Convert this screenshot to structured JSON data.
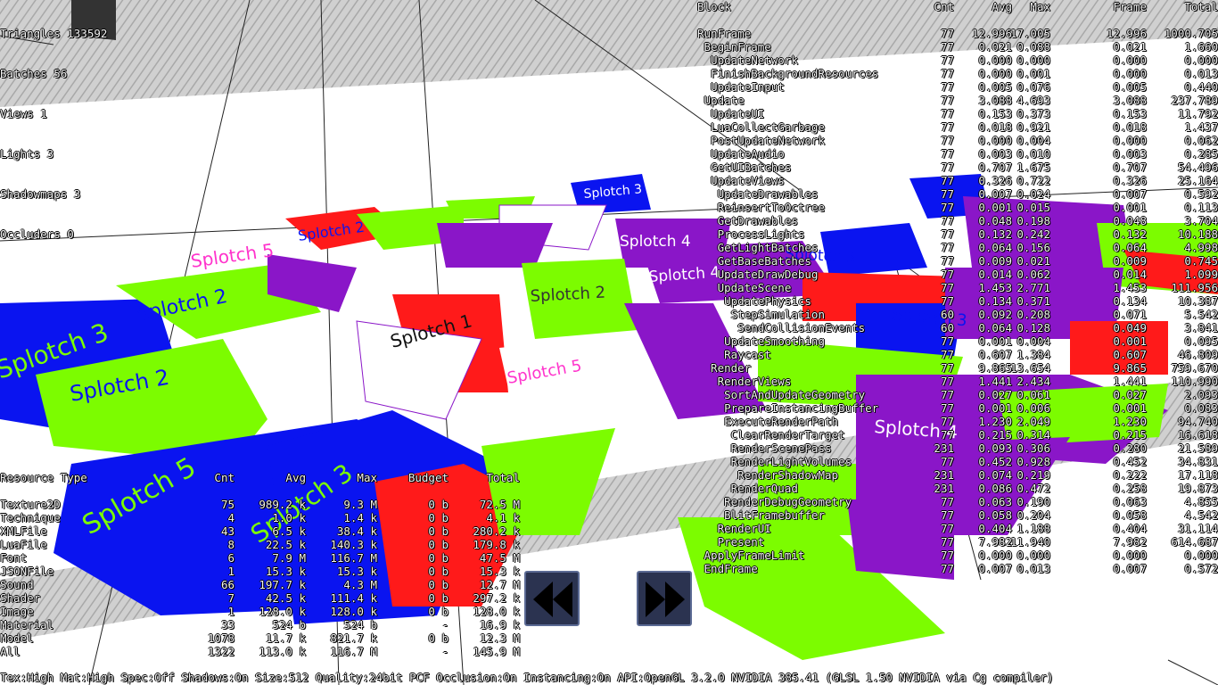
{
  "scene": {
    "splotch_labels": [
      "Splotch 1",
      "Splotch 2",
      "Splotch 3",
      "Splotch 4",
      "Splotch 5"
    ],
    "colors": {
      "green": "#7cfc00",
      "blue": "#0a14f0",
      "purple": "#8a16c8",
      "red": "#ff1a1a",
      "magenta": "#ff33cc",
      "white": "#ffffff",
      "slab": "#c8c8c8"
    }
  },
  "stats": [
    "Triangles 133592",
    "Batches 56",
    "Views 1",
    "Lights 3",
    "Shadowmaps 3",
    "Occluders 0"
  ],
  "profiler": {
    "headers": {
      "block": "Block",
      "cnt": "Cnt",
      "avg": "Avg",
      "max": "Max",
      "frame": "Frame",
      "total": "Total"
    },
    "rows": [
      {
        "name": "RunFrame",
        "cnt": "77",
        "avg": "12.996",
        "max": "17.005",
        "frame": "12.996",
        "total": "1000.705"
      },
      {
        "name": " BeginFrame",
        "cnt": "77",
        "avg": "0.021",
        "max": "0.088",
        "frame": "0.021",
        "total": "1.660"
      },
      {
        "name": "  UpdateNetwork",
        "cnt": "77",
        "avg": "0.000",
        "max": "0.000",
        "frame": "0.000",
        "total": "0.000"
      },
      {
        "name": "  FinishBackgroundResources",
        "cnt": "77",
        "avg": "0.000",
        "max": "0.001",
        "frame": "0.000",
        "total": "0.013"
      },
      {
        "name": "  UpdateInput",
        "cnt": "77",
        "avg": "0.005",
        "max": "0.076",
        "frame": "0.005",
        "total": "0.440"
      },
      {
        "name": " Update",
        "cnt": "77",
        "avg": "3.088",
        "max": "4.693",
        "frame": "3.088",
        "total": "237.789"
      },
      {
        "name": "  UpdateUI",
        "cnt": "77",
        "avg": "0.153",
        "max": "0.373",
        "frame": "0.153",
        "total": "11.792"
      },
      {
        "name": "  LuaCollectGarbage",
        "cnt": "77",
        "avg": "0.018",
        "max": "0.921",
        "frame": "0.018",
        "total": "1.437"
      },
      {
        "name": "  PostUpdateNetwork",
        "cnt": "77",
        "avg": "0.000",
        "max": "0.004",
        "frame": "0.000",
        "total": "0.062"
      },
      {
        "name": "  UpdateAudio",
        "cnt": "77",
        "avg": "0.003",
        "max": "0.010",
        "frame": "0.003",
        "total": "0.285"
      },
      {
        "name": "  GetUIBatches",
        "cnt": "77",
        "avg": "0.707",
        "max": "1.675",
        "frame": "0.707",
        "total": "54.496"
      },
      {
        "name": "  UpdateViews",
        "cnt": "77",
        "avg": "0.326",
        "max": "0.722",
        "frame": "0.326",
        "total": "25.164"
      },
      {
        "name": "   UpdateDrawables",
        "cnt": "77",
        "avg": "0.007",
        "max": "0.024",
        "frame": "0.007",
        "total": "0.592"
      },
      {
        "name": "   ReinsertToOctree",
        "cnt": "77",
        "avg": "0.001",
        "max": "0.015",
        "frame": "0.001",
        "total": "0.113"
      },
      {
        "name": "   GetDrawables",
        "cnt": "77",
        "avg": "0.048",
        "max": "0.198",
        "frame": "0.048",
        "total": "3.704"
      },
      {
        "name": "   ProcessLights",
        "cnt": "77",
        "avg": "0.132",
        "max": "0.242",
        "frame": "0.132",
        "total": "10.188"
      },
      {
        "name": "   GetLightBatches",
        "cnt": "77",
        "avg": "0.064",
        "max": "0.156",
        "frame": "0.064",
        "total": "4.998"
      },
      {
        "name": "   GetBaseBatches",
        "cnt": "77",
        "avg": "0.009",
        "max": "0.021",
        "frame": "0.009",
        "total": "0.745"
      },
      {
        "name": "   UpdateDrawDebug",
        "cnt": "77",
        "avg": "0.014",
        "max": "0.062",
        "frame": "0.014",
        "total": "1.099"
      },
      {
        "name": "   UpdateScene",
        "cnt": "77",
        "avg": "1.453",
        "max": "2.771",
        "frame": "1.453",
        "total": "111.956"
      },
      {
        "name": "    UpdatePhysics",
        "cnt": "77",
        "avg": "0.134",
        "max": "0.371",
        "frame": "0.134",
        "total": "10.387"
      },
      {
        "name": "     StepSimulation",
        "cnt": "60",
        "avg": "0.092",
        "max": "0.208",
        "frame": "0.071",
        "total": "5.542"
      },
      {
        "name": "      SendCollisionEvents",
        "cnt": "60",
        "avg": "0.064",
        "max": "0.128",
        "frame": "0.049",
        "total": "3.841"
      },
      {
        "name": "    UpdateSmoothing",
        "cnt": "77",
        "avg": "0.001",
        "max": "0.004",
        "frame": "0.001",
        "total": "0.095"
      },
      {
        "name": "    Raycast",
        "cnt": "77",
        "avg": "0.607",
        "max": "1.384",
        "frame": "0.607",
        "total": "46.809"
      },
      {
        "name": "  Render",
        "cnt": "77",
        "avg": "9.865",
        "max": "13.654",
        "frame": "9.865",
        "total": "759.670"
      },
      {
        "name": "   RenderViews",
        "cnt": "77",
        "avg": "1.441",
        "max": "2.434",
        "frame": "1.441",
        "total": "110.990"
      },
      {
        "name": "    SortAndUpdateGeometry",
        "cnt": "77",
        "avg": "0.027",
        "max": "0.061",
        "frame": "0.027",
        "total": "2.093"
      },
      {
        "name": "    PrepareInstancingBuffer",
        "cnt": "77",
        "avg": "0.001",
        "max": "0.006",
        "frame": "0.001",
        "total": "0.083"
      },
      {
        "name": "    ExecuteRenderPath",
        "cnt": "77",
        "avg": "1.230",
        "max": "2.049",
        "frame": "1.230",
        "total": "94.740"
      },
      {
        "name": "     ClearRenderTarget",
        "cnt": "77",
        "avg": "0.215",
        "max": "0.314",
        "frame": "0.215",
        "total": "16.618"
      },
      {
        "name": "     RenderScenePass",
        "cnt": "231",
        "avg": "0.093",
        "max": "0.306",
        "frame": "0.280",
        "total": "21.589"
      },
      {
        "name": "     RenderLightVolumes",
        "cnt": "77",
        "avg": "0.452",
        "max": "0.928",
        "frame": "0.452",
        "total": "34.831"
      },
      {
        "name": "      RenderShadowMap",
        "cnt": "231",
        "avg": "0.074",
        "max": "0.219",
        "frame": "0.222",
        "total": "17.118"
      },
      {
        "name": "     RenderQuad",
        "cnt": "231",
        "avg": "0.086",
        "max": "0.472",
        "frame": "0.258",
        "total": "19.873"
      },
      {
        "name": "    RenderDebugGeometry",
        "cnt": "77",
        "avg": "0.063",
        "max": "0.190",
        "frame": "0.063",
        "total": "4.855"
      },
      {
        "name": "    BlitFramebuffer",
        "cnt": "77",
        "avg": "0.058",
        "max": "0.204",
        "frame": "0.058",
        "total": "4.542"
      },
      {
        "name": "   RenderUI",
        "cnt": "77",
        "avg": "0.404",
        "max": "1.188",
        "frame": "0.404",
        "total": "31.114"
      },
      {
        "name": "   Present",
        "cnt": "77",
        "avg": "7.982",
        "max": "11.940",
        "frame": "7.982",
        "total": "614.687"
      },
      {
        "name": " ApplyFrameLimit",
        "cnt": "77",
        "avg": "0.000",
        "max": "0.000",
        "frame": "0.000",
        "total": "0.000"
      },
      {
        "name": " EndFrame",
        "cnt": "77",
        "avg": "0.007",
        "max": "0.013",
        "frame": "0.007",
        "total": "0.572"
      }
    ]
  },
  "resources": {
    "headers": {
      "type": "Resource Type",
      "cnt": "Cnt",
      "avg": "Avg",
      "max": "Max",
      "budget": "Budget",
      "total": "Total"
    },
    "rows": [
      {
        "type": "Texture2D",
        "cnt": "75",
        "avg": "989.2 k",
        "max": "9.3 M",
        "budget": "0 b",
        "total": "72.5 M"
      },
      {
        "type": "Technique",
        "cnt": "4",
        "avg": "1.0 k",
        "max": "1.4 k",
        "budget": "0 b",
        "total": "4.1 k"
      },
      {
        "type": "XMLFile",
        "cnt": "43",
        "avg": "6.5 k",
        "max": "38.4 k",
        "budget": "0 b",
        "total": "280.2 k"
      },
      {
        "type": "LuaFile",
        "cnt": "8",
        "avg": "22.5 k",
        "max": "140.3 k",
        "budget": "0 b",
        "total": "179.8 k"
      },
      {
        "type": "Font",
        "cnt": "6",
        "avg": "7.9 M",
        "max": "116.7 M",
        "budget": "0 b",
        "total": "47.5 M"
      },
      {
        "type": "JSONFile",
        "cnt": "1",
        "avg": "15.3 k",
        "max": "15.3 k",
        "budget": "0 b",
        "total": "15.3 k"
      },
      {
        "type": "Sound",
        "cnt": "66",
        "avg": "197.7 k",
        "max": "4.3 M",
        "budget": "0 b",
        "total": "12.7 M"
      },
      {
        "type": "Shader",
        "cnt": "7",
        "avg": "42.5 k",
        "max": "111.4 k",
        "budget": "0 b",
        "total": "297.2 k"
      },
      {
        "type": "Image",
        "cnt": "1",
        "avg": "128.0 k",
        "max": "128.0 k",
        "budget": "0 b",
        "total": "128.0 k"
      },
      {
        "type": "Material",
        "cnt": "33",
        "avg": "524 b",
        "max": "524 b",
        "budget": "-",
        "total": "16.9 k"
      },
      {
        "type": "Model",
        "cnt": "1078",
        "avg": "11.7 k",
        "max": "821.7 k",
        "budget": "0 b",
        "total": "12.3 M"
      },
      {
        "type": "All",
        "cnt": "1322",
        "avg": "113.0 k",
        "max": "116.7 M",
        "budget": "-",
        "total": "145.9 M"
      }
    ]
  },
  "footer": "Tex:High Mat:High Spec:Off Shadows:On Size:512 Quality:24bit PCF Occlusion:On Instancing:On API:OpenGL 3.2.0 NVIDIA 385.41 (GLSL 1.50 NVIDIA via Cg compiler)",
  "nav": {
    "prev_icon": "rewind-icon",
    "next_icon": "fast-forward-icon"
  }
}
